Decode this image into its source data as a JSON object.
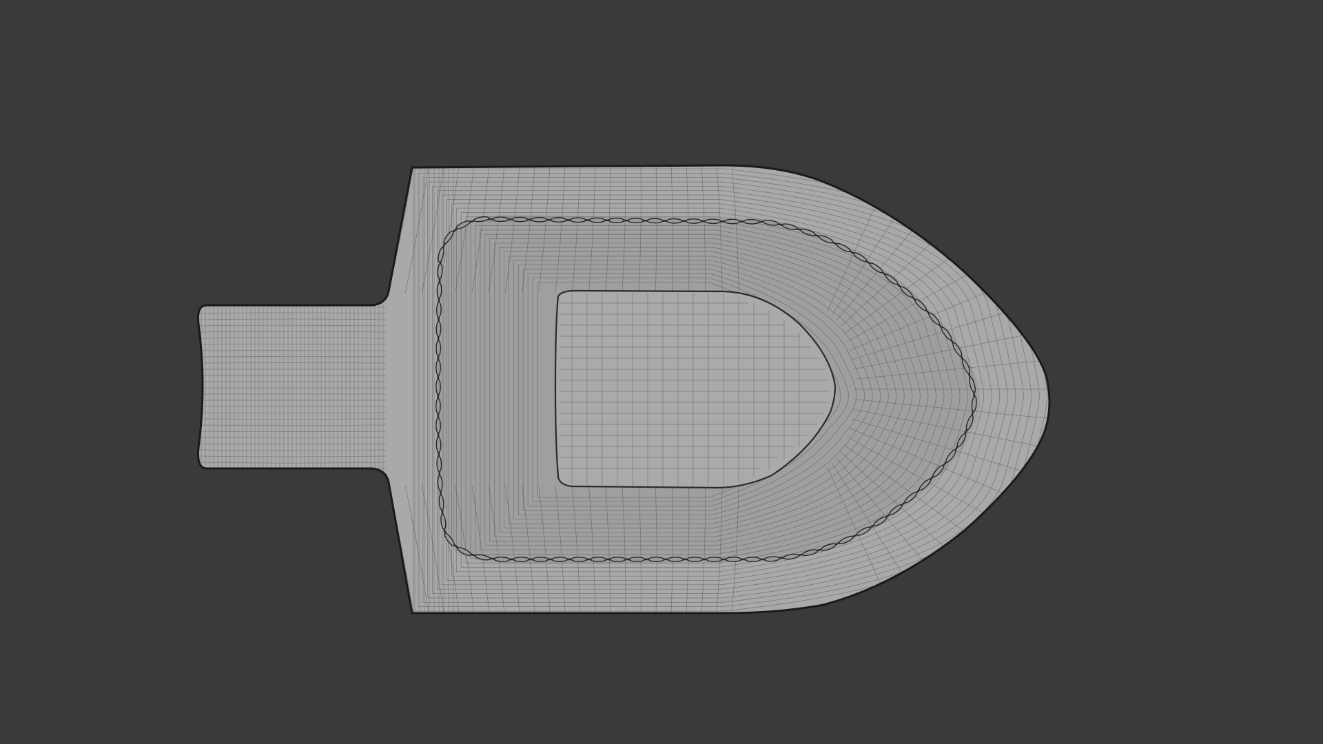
{
  "viewport": {
    "background": "#3a3a3a",
    "object": "wireframe-mesh",
    "mesh_color": "#a8a8a8",
    "wire_color": "#5a5a5a",
    "outline_color": "#1c1c1c"
  }
}
